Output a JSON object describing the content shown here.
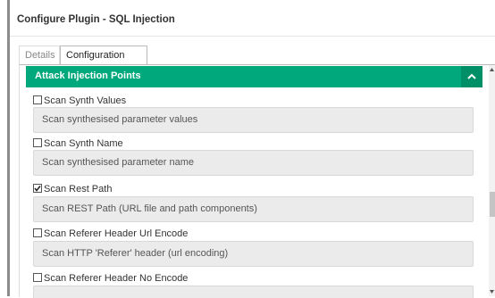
{
  "window": {
    "title": "Configure Plugin - SQL Injection"
  },
  "tabs": [
    {
      "label": "Details",
      "active": false
    },
    {
      "label": "Configuration",
      "active": true
    }
  ],
  "panel": {
    "title": "Attack Injection Points",
    "toggle_icon": "chevron-up-icon",
    "accent_color": "#00a87b"
  },
  "options": [
    {
      "label": "Scan Synth Values",
      "checked": false,
      "description": "Scan synthesised parameter values"
    },
    {
      "label": "Scan Synth Name",
      "checked": false,
      "description": "Scan synthesised parameter name"
    },
    {
      "label": "Scan Rest Path",
      "checked": true,
      "description": "Scan REST Path (URL file and path components)"
    },
    {
      "label": "Scan Referer Header Url Encode",
      "checked": false,
      "description": "Scan HTTP 'Referer' header (url encoding)"
    },
    {
      "label": "Scan Referer Header No Encode",
      "checked": false,
      "description": ""
    }
  ]
}
